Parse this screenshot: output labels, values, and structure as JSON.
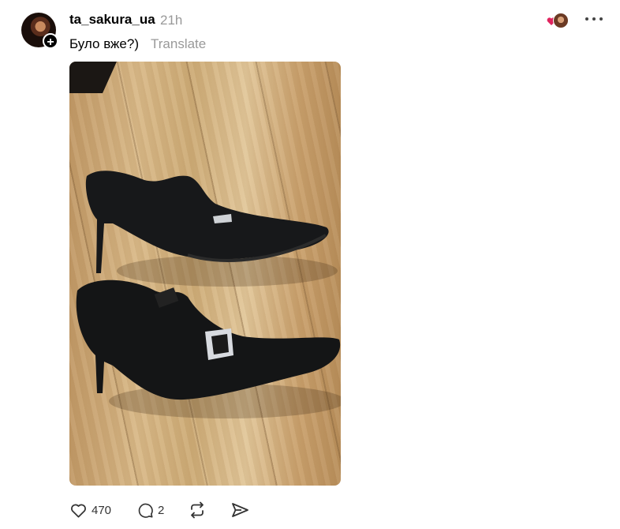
{
  "post": {
    "username": "ta_sakura_ua",
    "timestamp": "21h",
    "caption": "Було вже?)",
    "translate_label": "Translate",
    "image_alt": "Photo of a pair of black suede high-heeled shoes with rhinestone buckles lying on a wooden floor",
    "likes": "470",
    "replies": "2",
    "like_color": "#e0245e"
  },
  "icons": {
    "avatar_plus": "+",
    "liked_by": "heart-avatar-icon",
    "more": "more-dots-icon",
    "like": "heart-icon",
    "reply": "comment-icon",
    "repost": "repost-icon",
    "share": "share-icon"
  }
}
